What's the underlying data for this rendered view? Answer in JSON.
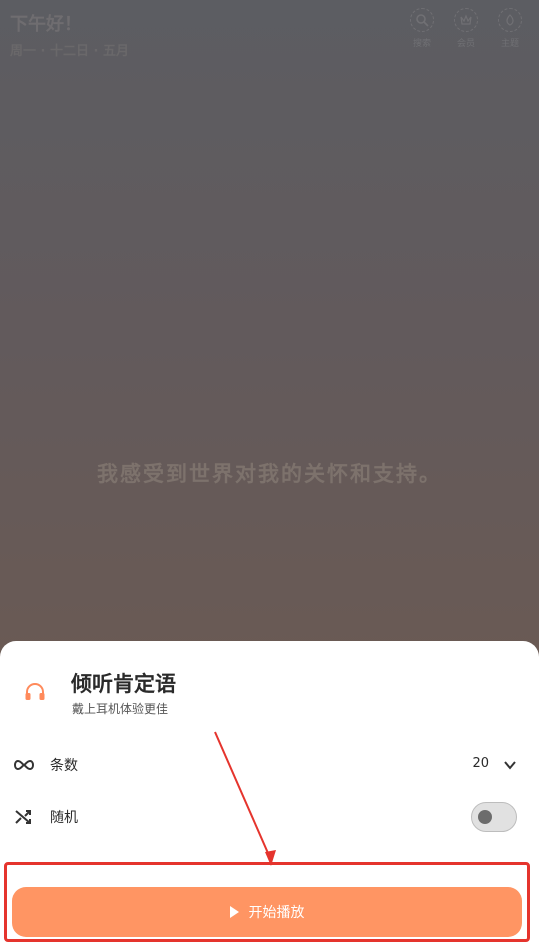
{
  "header": {
    "greeting": "下午好！",
    "date": "周一 · 十二日 · 五月",
    "actions": [
      {
        "label": "搜索",
        "icon": "search-icon"
      },
      {
        "label": "会员",
        "icon": "vip-icon"
      },
      {
        "label": "主题",
        "icon": "theme-icon"
      }
    ]
  },
  "quote": "我感受到世界对我的关怀和支持。",
  "sheet": {
    "title": "倾听肯定语",
    "subtitle": "戴上耳机体验更佳",
    "rows": {
      "count": {
        "label": "条数",
        "value": "20",
        "icon": "infinity-icon"
      },
      "shuffle": {
        "label": "随机",
        "icon": "shuffle-icon",
        "enabled": false
      }
    },
    "start_label": "开始播放"
  },
  "colors": {
    "accent": "#ff9563",
    "annotation": "#e5342d"
  }
}
